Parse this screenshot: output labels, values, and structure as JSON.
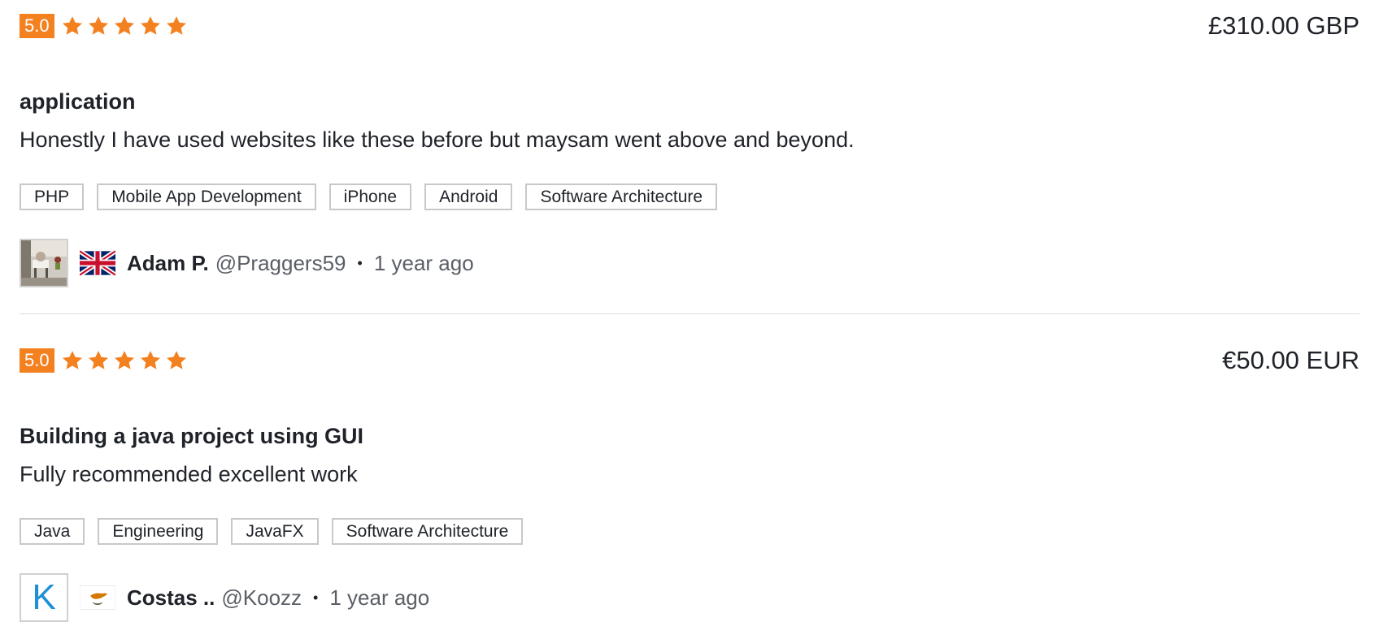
{
  "reviews": [
    {
      "score": "5.0",
      "stars": 5,
      "price": "£310.00 GBP",
      "title": "application",
      "text": "Honestly I have used websites like these before but maysam went above and beyond.",
      "tags": [
        "PHP",
        "Mobile App Development",
        "iPhone",
        "Android",
        "Software Architecture"
      ],
      "user": {
        "avatar": "photo",
        "flag": "uk-flag-icon",
        "name": "Adam P.",
        "handle": "@Praggers59",
        "time": "1 year ago"
      }
    },
    {
      "score": "5.0",
      "stars": 5,
      "price": "€50.00 EUR",
      "title": "Building a java project using GUI",
      "text": "Fully recommended excellent work",
      "tags": [
        "Java",
        "Engineering",
        "JavaFX",
        "Software Architecture"
      ],
      "user": {
        "avatar_letter": "K",
        "flag": "cyprus-flag-icon",
        "name": "Costas ..",
        "handle": "@Koozz",
        "time": "1 year ago"
      }
    }
  ],
  "colors": {
    "accent": "#f48120",
    "avatar_letter": "#1e90d6",
    "text": "#1f2329",
    "muted": "#5a5f66",
    "border": "#c8c8c8"
  },
  "separator": "•"
}
